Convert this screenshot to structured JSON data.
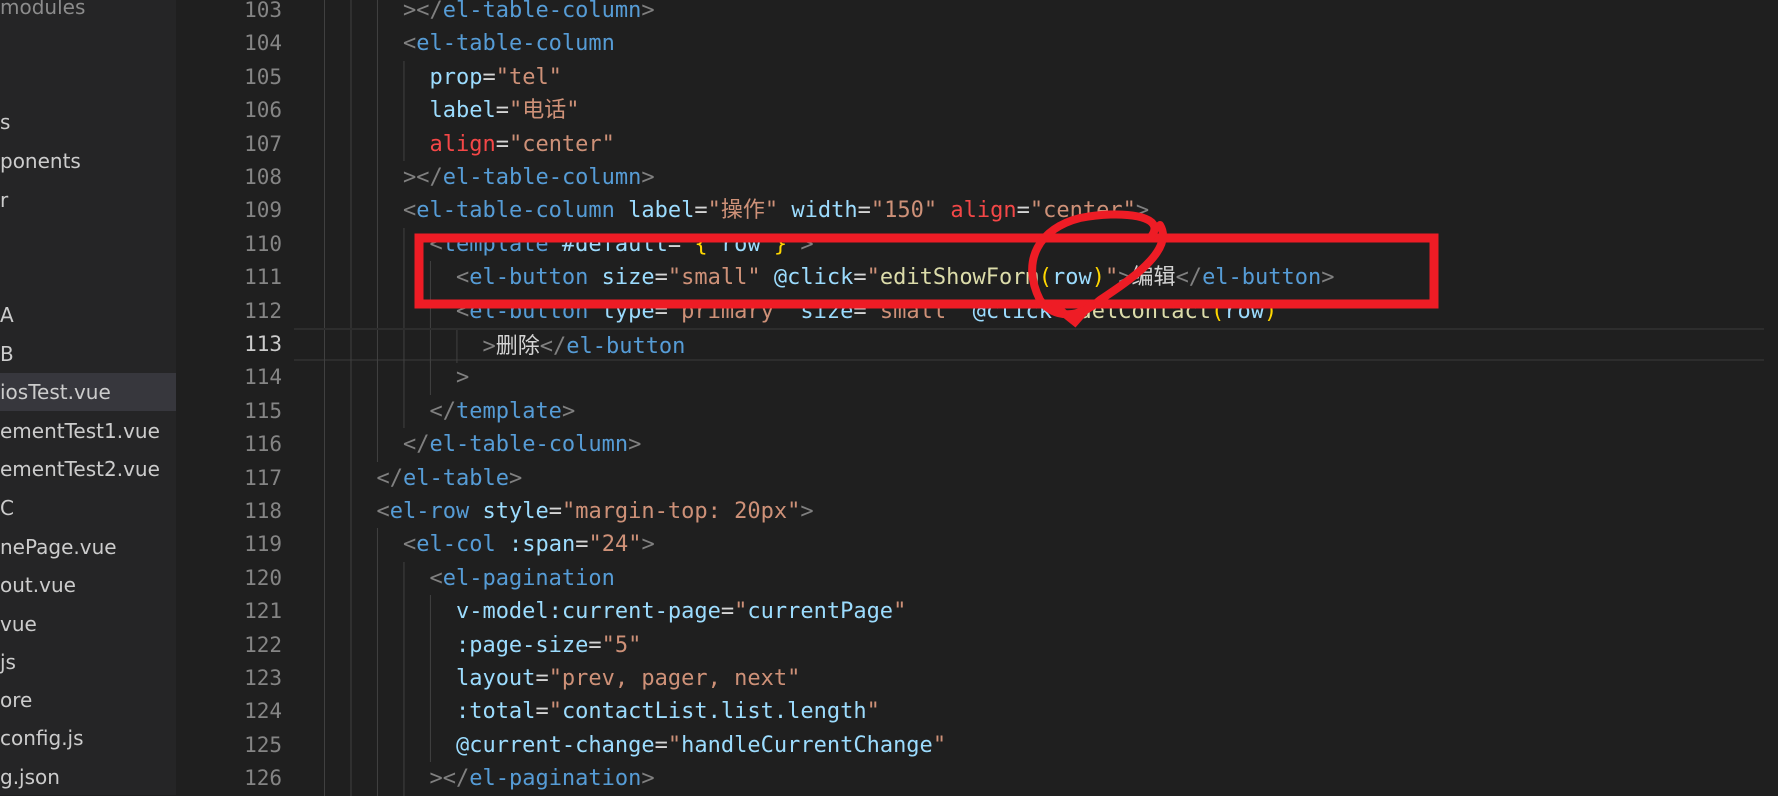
{
  "explorer": {
    "items": [
      {
        "label": "modules",
        "dim": true
      },
      {
        "label": "s"
      },
      {
        "label": "ponents"
      },
      {
        "label": "r"
      },
      {
        "label": "A"
      },
      {
        "label": "B"
      },
      {
        "label": "iosTest.vue",
        "active": true
      },
      {
        "label": "ementTest1.vue"
      },
      {
        "label": "ementTest2.vue"
      },
      {
        "label": "C"
      },
      {
        "label": "nePage.vue"
      },
      {
        "label": "out.vue"
      },
      {
        "label": "vue"
      },
      {
        "label": "js"
      },
      {
        "label": "ore"
      },
      {
        "label": "config.js"
      },
      {
        "label": "g.json"
      }
    ]
  },
  "editor": {
    "current_line": 113,
    "lines": [
      {
        "n": "103",
        "indent": 8,
        "tokens": [
          [
            ">",
            "p"
          ],
          [
            "</",
            "p"
          ],
          [
            "el-table-column",
            "t"
          ],
          [
            ">",
            "p"
          ]
        ]
      },
      {
        "n": "104",
        "indent": 8,
        "tokens": [
          [
            "<",
            "p"
          ],
          [
            "el-table-column",
            "t"
          ]
        ]
      },
      {
        "n": "105",
        "indent": 10,
        "tokens": [
          [
            "prop",
            "a"
          ],
          [
            "=",
            "x"
          ],
          [
            "\"tel\"",
            "s"
          ]
        ]
      },
      {
        "n": "106",
        "indent": 10,
        "tokens": [
          [
            "label",
            "a"
          ],
          [
            "=",
            "x"
          ],
          [
            "\"电话\"",
            "s"
          ]
        ]
      },
      {
        "n": "107",
        "indent": 10,
        "tokens": [
          [
            "align",
            "r"
          ],
          [
            "=",
            "x"
          ],
          [
            "\"center\"",
            "s"
          ]
        ]
      },
      {
        "n": "108",
        "indent": 8,
        "tokens": [
          [
            ">",
            "p"
          ],
          [
            "</",
            "p"
          ],
          [
            "el-table-column",
            "t"
          ],
          [
            ">",
            "p"
          ]
        ]
      },
      {
        "n": "109",
        "indent": 8,
        "tokens": [
          [
            "<",
            "p"
          ],
          [
            "el-table-column",
            "t"
          ],
          [
            " label",
            "a"
          ],
          [
            "=",
            "x"
          ],
          [
            "\"操作\"",
            "s"
          ],
          [
            " width",
            "a"
          ],
          [
            "=",
            "x"
          ],
          [
            "\"150\"",
            "s"
          ],
          [
            " align",
            "r"
          ],
          [
            "=",
            "x"
          ],
          [
            "\"center\"",
            "s"
          ],
          [
            ">",
            "p"
          ]
        ]
      },
      {
        "n": "110",
        "indent": 10,
        "tokens": [
          [
            "<",
            "p"
          ],
          [
            "template",
            "t"
          ],
          [
            " #default",
            "a"
          ],
          [
            "=",
            "x"
          ],
          [
            "\"",
            "s"
          ],
          [
            "{",
            "b"
          ],
          [
            " row ",
            "v"
          ],
          [
            "}",
            "b"
          ],
          [
            "\"",
            "s"
          ],
          [
            ">",
            "p"
          ]
        ]
      },
      {
        "n": "111",
        "indent": 12,
        "tokens": [
          [
            "<",
            "p"
          ],
          [
            "el-button",
            "t"
          ],
          [
            " size",
            "a"
          ],
          [
            "=",
            "x"
          ],
          [
            "\"small\"",
            "s"
          ],
          [
            " @click",
            "a"
          ],
          [
            "=",
            "x"
          ],
          [
            "\"",
            "s"
          ],
          [
            "editShowForm",
            "f"
          ],
          [
            "(",
            "b"
          ],
          [
            "row",
            "v"
          ],
          [
            ")",
            "b"
          ],
          [
            "\"",
            "s"
          ],
          [
            ">",
            "p"
          ],
          [
            "编辑",
            "x"
          ],
          [
            "</",
            "p"
          ],
          [
            "el-button",
            "t"
          ],
          [
            ">",
            "p"
          ]
        ]
      },
      {
        "n": "112",
        "indent": 12,
        "tokens": [
          [
            "<",
            "p"
          ],
          [
            "el-button",
            "t"
          ],
          [
            " type",
            "a"
          ],
          [
            "=",
            "x"
          ],
          [
            "\"primary\"",
            "s"
          ],
          [
            " size",
            "a"
          ],
          [
            "=",
            "x"
          ],
          [
            "\"small\"",
            "s"
          ],
          [
            " @click",
            "a"
          ],
          [
            "=",
            "x"
          ],
          [
            "\"",
            "s"
          ],
          [
            "delContact",
            "f"
          ],
          [
            "(",
            "b"
          ],
          [
            "row",
            "v"
          ],
          [
            ")",
            "b"
          ],
          [
            "\"",
            "s"
          ]
        ]
      },
      {
        "n": "113",
        "indent": 14,
        "tokens": [
          [
            ">",
            "p"
          ],
          [
            "删除",
            "x"
          ],
          [
            "</",
            "p"
          ],
          [
            "el-button",
            "t"
          ]
        ]
      },
      {
        "n": "114",
        "indent": 12,
        "tokens": [
          [
            ">",
            "p"
          ]
        ]
      },
      {
        "n": "115",
        "indent": 10,
        "tokens": [
          [
            "</",
            "p"
          ],
          [
            "template",
            "t"
          ],
          [
            ">",
            "p"
          ]
        ]
      },
      {
        "n": "116",
        "indent": 8,
        "tokens": [
          [
            "</",
            "p"
          ],
          [
            "el-table-column",
            "t"
          ],
          [
            ">",
            "p"
          ]
        ]
      },
      {
        "n": "117",
        "indent": 6,
        "tokens": [
          [
            "</",
            "p"
          ],
          [
            "el-table",
            "t"
          ],
          [
            ">",
            "p"
          ]
        ]
      },
      {
        "n": "118",
        "indent": 6,
        "tokens": [
          [
            "<",
            "p"
          ],
          [
            "el-row",
            "t"
          ],
          [
            " style",
            "a"
          ],
          [
            "=",
            "x"
          ],
          [
            "\"margin-top: 20px\"",
            "s"
          ],
          [
            ">",
            "p"
          ]
        ]
      },
      {
        "n": "119",
        "indent": 8,
        "tokens": [
          [
            "<",
            "p"
          ],
          [
            "el-col",
            "t"
          ],
          [
            " :span",
            "a"
          ],
          [
            "=",
            "x"
          ],
          [
            "\"24\"",
            "s"
          ],
          [
            ">",
            "p"
          ]
        ]
      },
      {
        "n": "120",
        "indent": 10,
        "tokens": [
          [
            "<",
            "p"
          ],
          [
            "el-pagination",
            "t"
          ]
        ]
      },
      {
        "n": "121",
        "indent": 12,
        "tokens": [
          [
            "v-model:current-page",
            "a"
          ],
          [
            "=",
            "x"
          ],
          [
            "\"",
            "s"
          ],
          [
            "currentPage",
            "v"
          ],
          [
            "\"",
            "s"
          ]
        ]
      },
      {
        "n": "122",
        "indent": 12,
        "tokens": [
          [
            ":page-size",
            "a"
          ],
          [
            "=",
            "x"
          ],
          [
            "\"",
            "s"
          ],
          [
            "5",
            "s"
          ],
          [
            "\"",
            "s"
          ]
        ]
      },
      {
        "n": "123",
        "indent": 12,
        "tokens": [
          [
            "layout",
            "a"
          ],
          [
            "=",
            "x"
          ],
          [
            "\"prev, pager, next\"",
            "s"
          ]
        ]
      },
      {
        "n": "124",
        "indent": 12,
        "tokens": [
          [
            ":total",
            "a"
          ],
          [
            "=",
            "x"
          ],
          [
            "\"",
            "s"
          ],
          [
            "contactList.list.length",
            "v"
          ],
          [
            "\"",
            "s"
          ]
        ]
      },
      {
        "n": "125",
        "indent": 12,
        "tokens": [
          [
            "@current-change",
            "a"
          ],
          [
            "=",
            "x"
          ],
          [
            "\"",
            "s"
          ],
          [
            "handleCurrentChange",
            "v"
          ],
          [
            "\"",
            "s"
          ]
        ]
      },
      {
        "n": "126",
        "indent": 10,
        "tokens": [
          [
            ">",
            "p"
          ],
          [
            "</",
            "p"
          ],
          [
            "el-pagination",
            "t"
          ],
          [
            ">",
            "p"
          ]
        ]
      }
    ]
  },
  "annotation": {
    "color": "#ee1c25",
    "shapes": [
      "rectangle",
      "ellipse"
    ]
  }
}
